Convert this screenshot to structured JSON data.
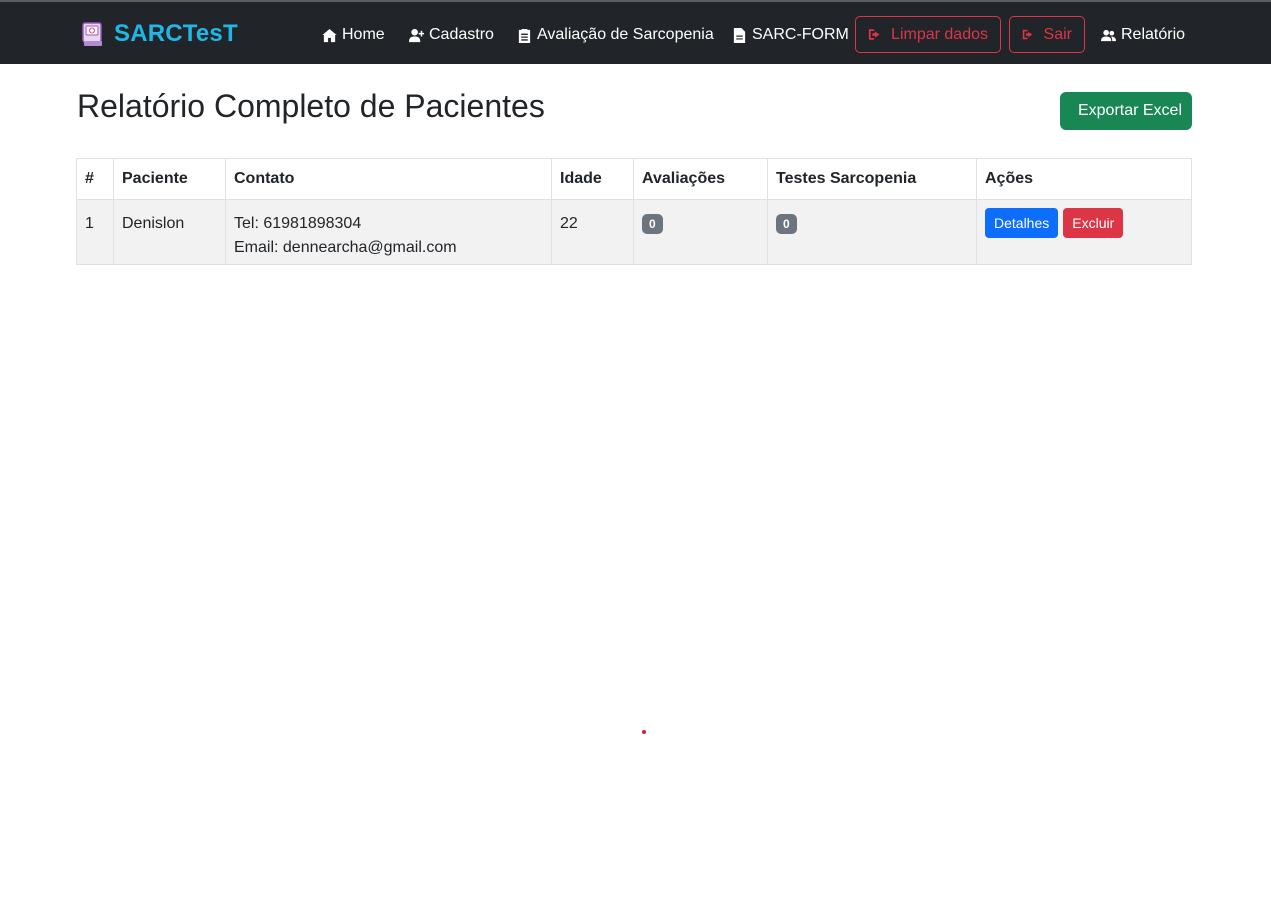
{
  "brand": {
    "name": "SARCTesT"
  },
  "nav": {
    "home": "Home",
    "cadastro": "Cadastro",
    "avaliacao": "Avaliação de Sarcopenia",
    "sarc_form": "SARC-FORM",
    "limpar": "Limpar dados",
    "sair": "Sair",
    "relatorio": "Relatório"
  },
  "page": {
    "title": "Relatório Completo de Pacientes",
    "export_label": "Exportar Excel"
  },
  "table": {
    "headers": [
      "#",
      "Paciente",
      "Contato",
      "Idade",
      "Avaliações",
      "Testes Sarcopenia",
      "Ações"
    ],
    "rows": [
      {
        "num": "1",
        "paciente": "Denislon",
        "tel": "Tel: 61981898304",
        "email": "Email: dennearcha@gmail.com",
        "idade": "22",
        "avaliacoes": "0",
        "testes": "0",
        "detalhes": "Detalhes",
        "excluir": "Excluir"
      }
    ]
  },
  "colors": {
    "navbar": "#212529",
    "brand": "#1fb8e6",
    "danger": "#dc3545",
    "success": "#198754",
    "primary": "#0d6efd",
    "badge": "#6c757d"
  }
}
